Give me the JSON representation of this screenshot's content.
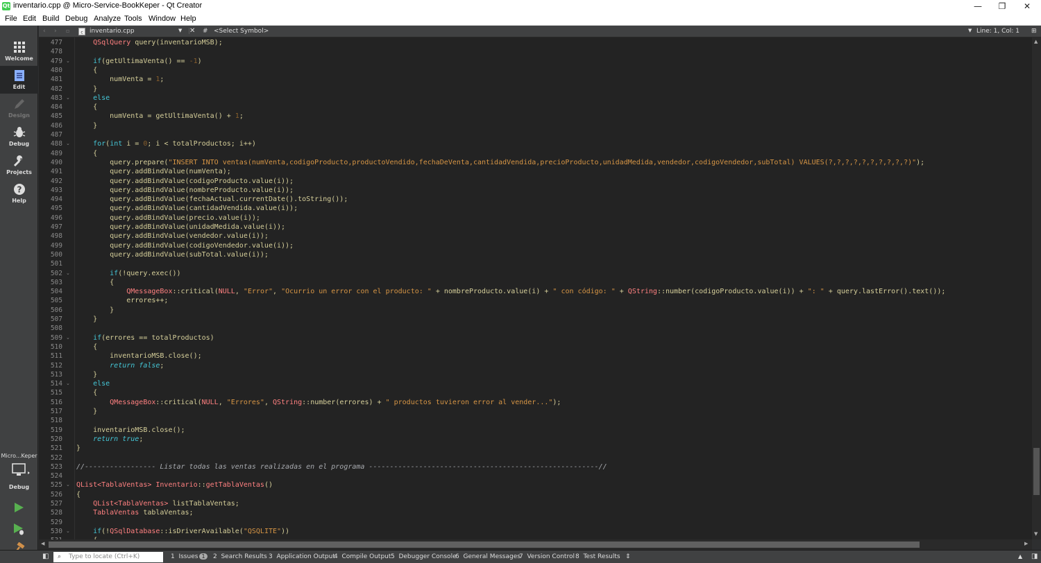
{
  "window": {
    "title": "inventario.cpp @ Micro-Service-BookKeper - Qt Creator",
    "minimize": "—",
    "restore": "❐",
    "close": "✕"
  },
  "menu": [
    "File",
    "Edit",
    "Build",
    "Debug",
    "Analyze",
    "Tools",
    "Window",
    "Help"
  ],
  "modes": {
    "welcome": "Welcome",
    "edit": "Edit",
    "design": "Design",
    "debug": "Debug",
    "projects": "Projects",
    "help": "Help"
  },
  "kit": {
    "project": "Micro...Keper",
    "build": "Debug"
  },
  "toolbar": {
    "file": "inventario.cpp",
    "hash": "#",
    "symbol": "<Select Symbol>",
    "position": "Line: 1, Col: 1"
  },
  "code": {
    "lines": [
      {
        "n": "477",
        "fold": "",
        "segs": [
          [
            "ty",
            "    QSqlQuery "
          ],
          [
            "pl",
            "query(inventarioMSB);"
          ]
        ]
      },
      {
        "n": "478",
        "fold": "",
        "segs": []
      },
      {
        "n": "479",
        "fold": "⌄",
        "segs": [
          [
            "kw",
            "    if"
          ],
          [
            "pl",
            "(getUltimaVenta() == "
          ],
          [
            "num",
            "-1"
          ],
          [
            "pl",
            ")"
          ]
        ]
      },
      {
        "n": "480",
        "fold": "",
        "segs": [
          [
            "pl",
            "    {"
          ]
        ]
      },
      {
        "n": "481",
        "fold": "",
        "segs": [
          [
            "pl",
            "        numVenta = "
          ],
          [
            "num",
            "1"
          ],
          [
            "pl",
            ";"
          ]
        ]
      },
      {
        "n": "482",
        "fold": "",
        "segs": [
          [
            "pl",
            "    }"
          ]
        ]
      },
      {
        "n": "483",
        "fold": "⌄",
        "segs": [
          [
            "kw",
            "    else"
          ]
        ]
      },
      {
        "n": "484",
        "fold": "",
        "segs": [
          [
            "pl",
            "    {"
          ]
        ]
      },
      {
        "n": "485",
        "fold": "",
        "segs": [
          [
            "pl",
            "        numVenta = getUltimaVenta() + "
          ],
          [
            "num",
            "1"
          ],
          [
            "pl",
            ";"
          ]
        ]
      },
      {
        "n": "486",
        "fold": "",
        "segs": [
          [
            "pl",
            "    }"
          ]
        ]
      },
      {
        "n": "487",
        "fold": "",
        "segs": []
      },
      {
        "n": "488",
        "fold": "⌄",
        "segs": [
          [
            "kw",
            "    for"
          ],
          [
            "pl",
            "("
          ],
          [
            "kw",
            "int"
          ],
          [
            "pl",
            " i = "
          ],
          [
            "num",
            "0"
          ],
          [
            "pl",
            "; i < totalProductos; i++)"
          ]
        ]
      },
      {
        "n": "489",
        "fold": "",
        "segs": [
          [
            "pl",
            "    {"
          ]
        ]
      },
      {
        "n": "490",
        "fold": "",
        "segs": [
          [
            "pl",
            "        query.prepare("
          ],
          [
            "str",
            "\"INSERT INTO ventas(numVenta,codigoProducto,productoVendido,fechaDeVenta,cantidadVendida,precioProducto,unidadMedida,vendedor,codigoVendedor,subTotal) VALUES(?,?,?,?,?,?,?,?,?,?)\""
          ],
          [
            "pl",
            ");"
          ]
        ]
      },
      {
        "n": "491",
        "fold": "",
        "segs": [
          [
            "pl",
            "        query.addBindValue(numVenta);"
          ]
        ]
      },
      {
        "n": "492",
        "fold": "",
        "segs": [
          [
            "pl",
            "        query.addBindValue(codigoProducto.value(i));"
          ]
        ]
      },
      {
        "n": "493",
        "fold": "",
        "segs": [
          [
            "pl",
            "        query.addBindValue(nombreProducto.value(i));"
          ]
        ]
      },
      {
        "n": "494",
        "fold": "",
        "segs": [
          [
            "pl",
            "        query.addBindValue(fechaActual.currentDate().toString());"
          ]
        ]
      },
      {
        "n": "495",
        "fold": "",
        "segs": [
          [
            "pl",
            "        query.addBindValue(cantidadVendida.value(i));"
          ]
        ]
      },
      {
        "n": "496",
        "fold": "",
        "segs": [
          [
            "pl",
            "        query.addBindValue(precio.value(i));"
          ]
        ]
      },
      {
        "n": "497",
        "fold": "",
        "segs": [
          [
            "pl",
            "        query.addBindValue(unidadMedida.value(i));"
          ]
        ]
      },
      {
        "n": "498",
        "fold": "",
        "segs": [
          [
            "pl",
            "        query.addBindValue(vendedor.value(i));"
          ]
        ]
      },
      {
        "n": "499",
        "fold": "",
        "segs": [
          [
            "pl",
            "        query.addBindValue(codigoVendedor.value(i));"
          ]
        ]
      },
      {
        "n": "500",
        "fold": "",
        "segs": [
          [
            "pl",
            "        query.addBindValue(subTotal.value(i));"
          ]
        ]
      },
      {
        "n": "501",
        "fold": "",
        "segs": []
      },
      {
        "n": "502",
        "fold": "⌄",
        "segs": [
          [
            "kw",
            "        if"
          ],
          [
            "pl",
            "(!query.exec())"
          ]
        ]
      },
      {
        "n": "503",
        "fold": "",
        "segs": [
          [
            "pl",
            "        {"
          ]
        ]
      },
      {
        "n": "504",
        "fold": "",
        "segs": [
          [
            "ty",
            "            QMessageBox"
          ],
          [
            "pl",
            "::critical("
          ],
          [
            "ty",
            "NULL"
          ],
          [
            "pl",
            ", "
          ],
          [
            "str",
            "\"Error\""
          ],
          [
            "pl",
            ", "
          ],
          [
            "str",
            "\"Ocurrio un error con el producto: \""
          ],
          [
            "pl",
            " + nombreProducto.value(i) + "
          ],
          [
            "str",
            "\" con código: \""
          ],
          [
            "pl",
            " + "
          ],
          [
            "ty",
            "QString"
          ],
          [
            "pl",
            "::number(codigoProducto.value(i)) + "
          ],
          [
            "str",
            "\": \""
          ],
          [
            "pl",
            " + query.lastError().text());"
          ]
        ]
      },
      {
        "n": "505",
        "fold": "",
        "segs": [
          [
            "pl",
            "            errores++;"
          ]
        ]
      },
      {
        "n": "506",
        "fold": "",
        "segs": [
          [
            "pl",
            "        }"
          ]
        ]
      },
      {
        "n": "507",
        "fold": "",
        "segs": [
          [
            "pl",
            "    }"
          ]
        ]
      },
      {
        "n": "508",
        "fold": "",
        "segs": []
      },
      {
        "n": "509",
        "fold": "⌄",
        "segs": [
          [
            "kw",
            "    if"
          ],
          [
            "pl",
            "(errores == totalProductos)"
          ]
        ]
      },
      {
        "n": "510",
        "fold": "",
        "segs": [
          [
            "pl",
            "    {"
          ]
        ]
      },
      {
        "n": "511",
        "fold": "",
        "segs": [
          [
            "pl",
            "        inventarioMSB.close();"
          ]
        ]
      },
      {
        "n": "512",
        "fold": "",
        "segs": [
          [
            "kwi",
            "        return false"
          ],
          [
            "pl",
            ";"
          ]
        ]
      },
      {
        "n": "513",
        "fold": "",
        "segs": [
          [
            "pl",
            "    }"
          ]
        ]
      },
      {
        "n": "514",
        "fold": "⌄",
        "segs": [
          [
            "kw",
            "    else"
          ]
        ]
      },
      {
        "n": "515",
        "fold": "",
        "segs": [
          [
            "pl",
            "    {"
          ]
        ]
      },
      {
        "n": "516",
        "fold": "",
        "segs": [
          [
            "ty",
            "        QMessageBox"
          ],
          [
            "pl",
            "::critical("
          ],
          [
            "ty",
            "NULL"
          ],
          [
            "pl",
            ", "
          ],
          [
            "str",
            "\"Errores\""
          ],
          [
            "pl",
            ", "
          ],
          [
            "ty",
            "QString"
          ],
          [
            "pl",
            "::number(errores) + "
          ],
          [
            "str",
            "\" productos tuvieron error al vender...\""
          ],
          [
            "pl",
            ");"
          ]
        ]
      },
      {
        "n": "517",
        "fold": "",
        "segs": [
          [
            "pl",
            "    }"
          ]
        ]
      },
      {
        "n": "518",
        "fold": "",
        "segs": []
      },
      {
        "n": "519",
        "fold": "",
        "segs": [
          [
            "pl",
            "    inventarioMSB.close();"
          ]
        ]
      },
      {
        "n": "520",
        "fold": "",
        "segs": [
          [
            "kwi",
            "    return true"
          ],
          [
            "pl",
            ";"
          ]
        ]
      },
      {
        "n": "521",
        "fold": "",
        "segs": [
          [
            "pl",
            "}"
          ]
        ]
      },
      {
        "n": "522",
        "fold": "",
        "segs": []
      },
      {
        "n": "523",
        "fold": "",
        "segs": [
          [
            "cmt",
            "//----------------- Listar todas las ventas realizadas en el programa -------------------------------------------------------//"
          ]
        ]
      },
      {
        "n": "524",
        "fold": "",
        "segs": []
      },
      {
        "n": "525",
        "fold": "⌄",
        "segs": [
          [
            "ty",
            "QList<TablaVentas> Inventario"
          ],
          [
            "pl",
            "::"
          ],
          [
            "ty",
            "getTablaVentas"
          ],
          [
            "pl",
            "()"
          ]
        ]
      },
      {
        "n": "526",
        "fold": "",
        "segs": [
          [
            "pl",
            "{"
          ]
        ]
      },
      {
        "n": "527",
        "fold": "",
        "segs": [
          [
            "ty",
            "    QList<TablaVentas>"
          ],
          [
            "pl",
            " listTablaVentas;"
          ]
        ]
      },
      {
        "n": "528",
        "fold": "",
        "segs": [
          [
            "ty",
            "    TablaVentas"
          ],
          [
            "pl",
            " tablaVentas;"
          ]
        ]
      },
      {
        "n": "529",
        "fold": "",
        "segs": []
      },
      {
        "n": "530",
        "fold": "⌄",
        "segs": [
          [
            "kw",
            "    if"
          ],
          [
            "pl",
            "(!"
          ],
          [
            "ty",
            "QSqlDatabase"
          ],
          [
            "pl",
            "::isDriverAvailable("
          ],
          [
            "str",
            "\"QSQLITE\""
          ],
          [
            "pl",
            "))"
          ]
        ]
      },
      {
        "n": "531",
        "fold": "",
        "segs": [
          [
            "pl",
            "    {"
          ]
        ]
      }
    ]
  },
  "status": {
    "locator_placeholder": "Type to locate (Ctrl+K)",
    "panes": [
      {
        "num": "1",
        "label": "Issues",
        "badge": "1"
      },
      {
        "num": "2",
        "label": "Search Results"
      },
      {
        "num": "3",
        "label": "Application Output"
      },
      {
        "num": "4",
        "label": "Compile Output"
      },
      {
        "num": "5",
        "label": "Debugger Console"
      },
      {
        "num": "6",
        "label": "General Messages"
      },
      {
        "num": "7",
        "label": "Version Control"
      },
      {
        "num": "8",
        "label": "Test Results"
      }
    ]
  }
}
